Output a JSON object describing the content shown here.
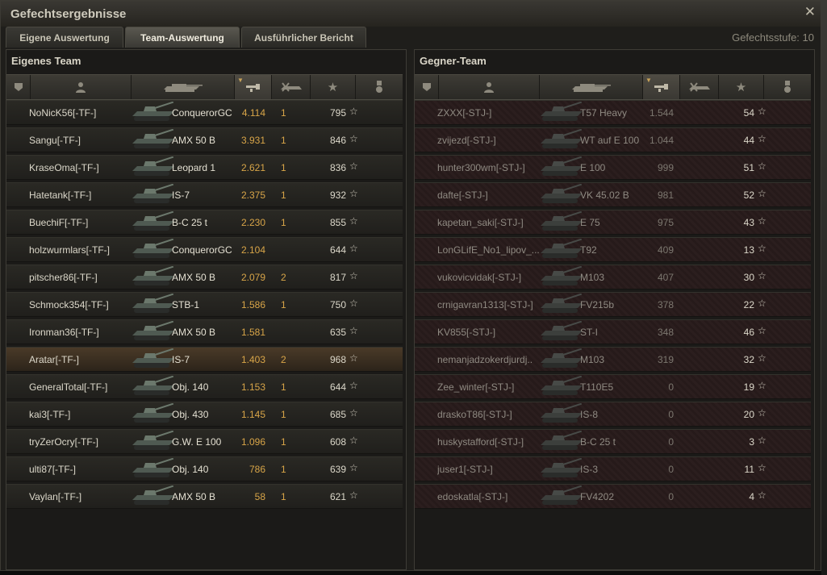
{
  "window": {
    "title": "Gefechtsergebnisse"
  },
  "tabs": [
    {
      "label": "Eigene Auswertung"
    },
    {
      "label": "Team-Auswertung"
    },
    {
      "label": "Ausführlicher Bericht"
    }
  ],
  "battle_level": "Gefechtsstufe: 10",
  "own_team": {
    "title": "Eigenes Team",
    "rows": [
      {
        "player": "NoNicK56[-TF-]",
        "tank": "ConquerorGC",
        "damage": "4.114",
        "kills": "1",
        "xp": "795"
      },
      {
        "player": "Sangu[-TF-]",
        "tank": "AMX 50 B",
        "damage": "3.931",
        "kills": "1",
        "xp": "846"
      },
      {
        "player": "KraseOma[-TF-]",
        "tank": "Leopard 1",
        "damage": "2.621",
        "kills": "1",
        "xp": "836"
      },
      {
        "player": "Hatetank[-TF-]",
        "tank": "IS-7",
        "damage": "2.375",
        "kills": "1",
        "xp": "932"
      },
      {
        "player": "BuechiF[-TF-]",
        "tank": "B-C 25 t",
        "damage": "2.230",
        "kills": "1",
        "xp": "855"
      },
      {
        "player": "holzwurmlars[-TF-]",
        "tank": "ConquerorGC",
        "damage": "2.104",
        "kills": "",
        "xp": "644"
      },
      {
        "player": "pitscher86[-TF-]",
        "tank": "AMX 50 B",
        "damage": "2.079",
        "kills": "2",
        "xp": "817"
      },
      {
        "player": "Schmock354[-TF-]",
        "tank": "STB-1",
        "damage": "1.586",
        "kills": "1",
        "xp": "750"
      },
      {
        "player": "Ironman36[-TF-]",
        "tank": "AMX 50 B",
        "damage": "1.581",
        "kills": "",
        "xp": "635"
      },
      {
        "player": "Aratar[-TF-]",
        "tank": "IS-7",
        "damage": "1.403",
        "kills": "2",
        "xp": "968"
      },
      {
        "player": "GeneralTotal[-TF-]",
        "tank": "Obj. 140",
        "damage": "1.153",
        "kills": "1",
        "xp": "644"
      },
      {
        "player": "kai3[-TF-]",
        "tank": "Obj. 430",
        "damage": "1.145",
        "kills": "1",
        "xp": "685"
      },
      {
        "player": "tryZerOcry[-TF-]",
        "tank": "G.W. E 100",
        "damage": "1.096",
        "kills": "1",
        "xp": "608"
      },
      {
        "player": "ulti87[-TF-]",
        "tank": "Obj. 140",
        "damage": "786",
        "kills": "1",
        "xp": "639"
      },
      {
        "player": "Vaylan[-TF-]",
        "tank": "AMX 50 B",
        "damage": "58",
        "kills": "1",
        "xp": "621"
      }
    ]
  },
  "enemy_team": {
    "title": "Gegner-Team",
    "rows": [
      {
        "player": "ZXXX[-STJ-]",
        "tank": "T57 Heavy",
        "damage": "1.544",
        "kills": "",
        "xp": "54"
      },
      {
        "player": "zvijezd[-STJ-]",
        "tank": "WT auf E 100",
        "damage": "1.044",
        "kills": "",
        "xp": "44"
      },
      {
        "player": "hunter300wm[-STJ-]",
        "tank": "E 100",
        "damage": "999",
        "kills": "",
        "xp": "51"
      },
      {
        "player": "dafte[-STJ-]",
        "tank": "VK 45.02 B",
        "damage": "981",
        "kills": "",
        "xp": "52"
      },
      {
        "player": "kapetan_saki[-STJ-]",
        "tank": "E 75",
        "damage": "975",
        "kills": "",
        "xp": "43"
      },
      {
        "player": "LonGLifE_No1_lipov_...",
        "tank": "T92",
        "damage": "409",
        "kills": "",
        "xp": "13"
      },
      {
        "player": "vukovicvidak[-STJ-]",
        "tank": "M103",
        "damage": "407",
        "kills": "",
        "xp": "30"
      },
      {
        "player": "crnigavran1313[-STJ-]",
        "tank": "FV215b",
        "damage": "378",
        "kills": "",
        "xp": "22"
      },
      {
        "player": "KV855[-STJ-]",
        "tank": "ST-I",
        "damage": "348",
        "kills": "",
        "xp": "46"
      },
      {
        "player": "nemanjadzokerdjurdj..",
        "tank": "M103",
        "damage": "319",
        "kills": "",
        "xp": "32"
      },
      {
        "player": "Zee_winter[-STJ-]",
        "tank": "T110E5",
        "damage": "0",
        "kills": "",
        "xp": "19"
      },
      {
        "player": "draskoT86[-STJ-]",
        "tank": "IS-8",
        "damage": "0",
        "kills": "",
        "xp": "20"
      },
      {
        "player": "huskystafford[-STJ-]",
        "tank": "B-C 25 t",
        "damage": "0",
        "kills": "",
        "xp": "3"
      },
      {
        "player": "juser1[-STJ-]",
        "tank": "IS-3",
        "damage": "0",
        "kills": "",
        "xp": "11"
      },
      {
        "player": "edoskatla[-STJ-]",
        "tank": "FV4202",
        "damage": "0",
        "kills": "",
        "xp": "4"
      }
    ]
  }
}
